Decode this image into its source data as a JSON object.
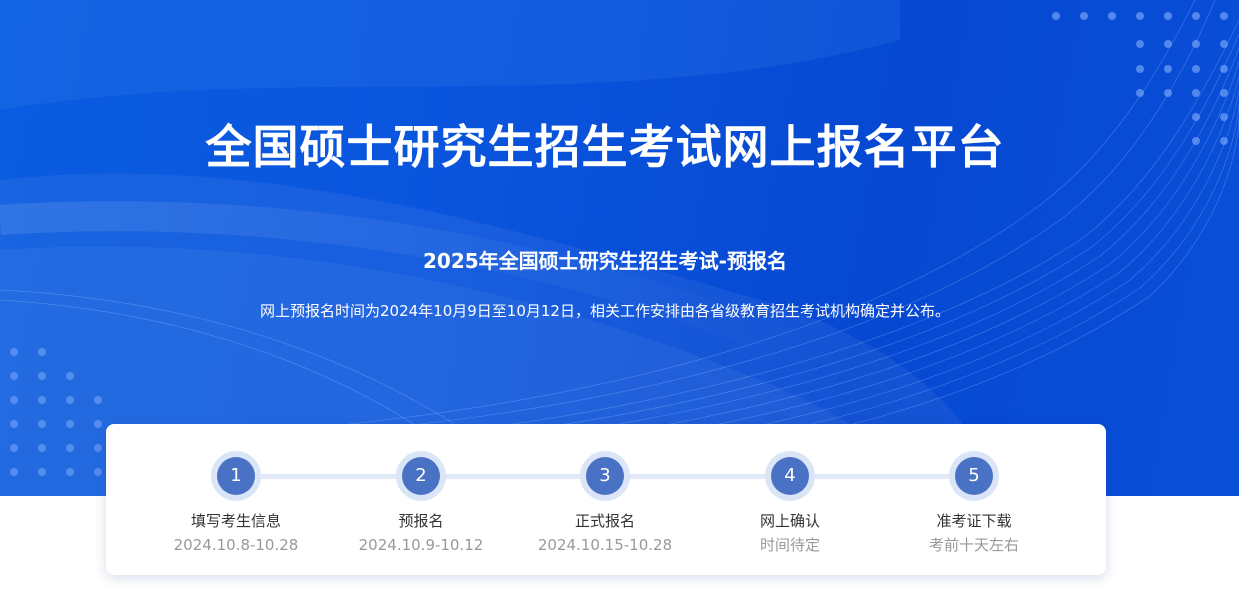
{
  "hero": {
    "title": "全国硕士研究生招生考试网上报名平台",
    "subtitle": "2025年全国硕士研究生招生考试-预报名",
    "description": "网上预报名时间为2024年10月9日至10月12日，相关工作安排由各省级教育招生考试机构确定并公布。"
  },
  "steps": [
    {
      "number": "1",
      "label": "填写考生信息",
      "date": "2024.10.8-10.28"
    },
    {
      "number": "2",
      "label": "预报名",
      "date": "2024.10.9-10.12"
    },
    {
      "number": "3",
      "label": "正式报名",
      "date": "2024.10.15-10.28"
    },
    {
      "number": "4",
      "label": "网上确认",
      "date": "时间待定"
    },
    {
      "number": "5",
      "label": "准考证下载",
      "date": "考前十天左右"
    }
  ],
  "colors": {
    "hero_blue": "#0a55dd",
    "step_circle": "#4a72c4",
    "step_ring": "#dbe5f8",
    "label_text": "#333333",
    "date_text": "#999999"
  }
}
